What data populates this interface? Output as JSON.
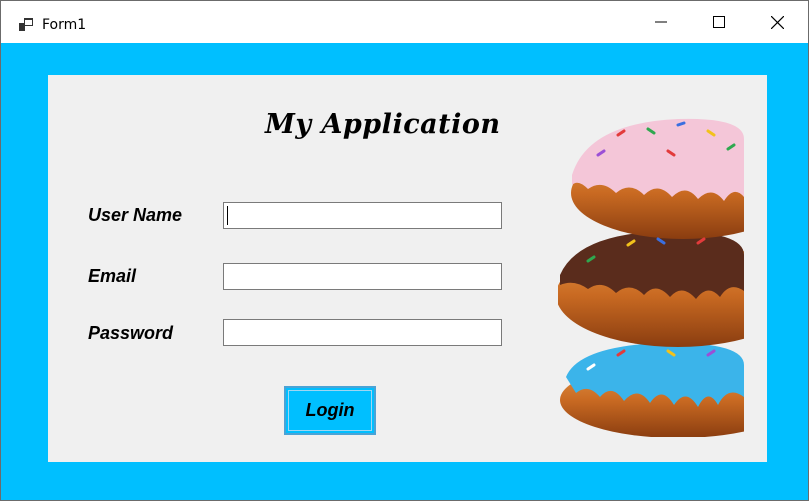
{
  "window": {
    "title": "Form1",
    "controls": [
      "minimize-icon",
      "maximize-icon",
      "close-icon"
    ]
  },
  "form": {
    "heading": "My Application",
    "fields": [
      {
        "label": "User Name",
        "value": "",
        "placeholder": ""
      },
      {
        "label": "Email",
        "value": "",
        "placeholder": ""
      },
      {
        "label": "Password",
        "value": "",
        "placeholder": ""
      }
    ],
    "login_label": "Login"
  },
  "colors": {
    "background": "#00bfff",
    "panel": "#f0f0f0",
    "button": "#00bfff",
    "titlebar": "#ffffff"
  },
  "image": {
    "subject": "stacked-donuts"
  }
}
